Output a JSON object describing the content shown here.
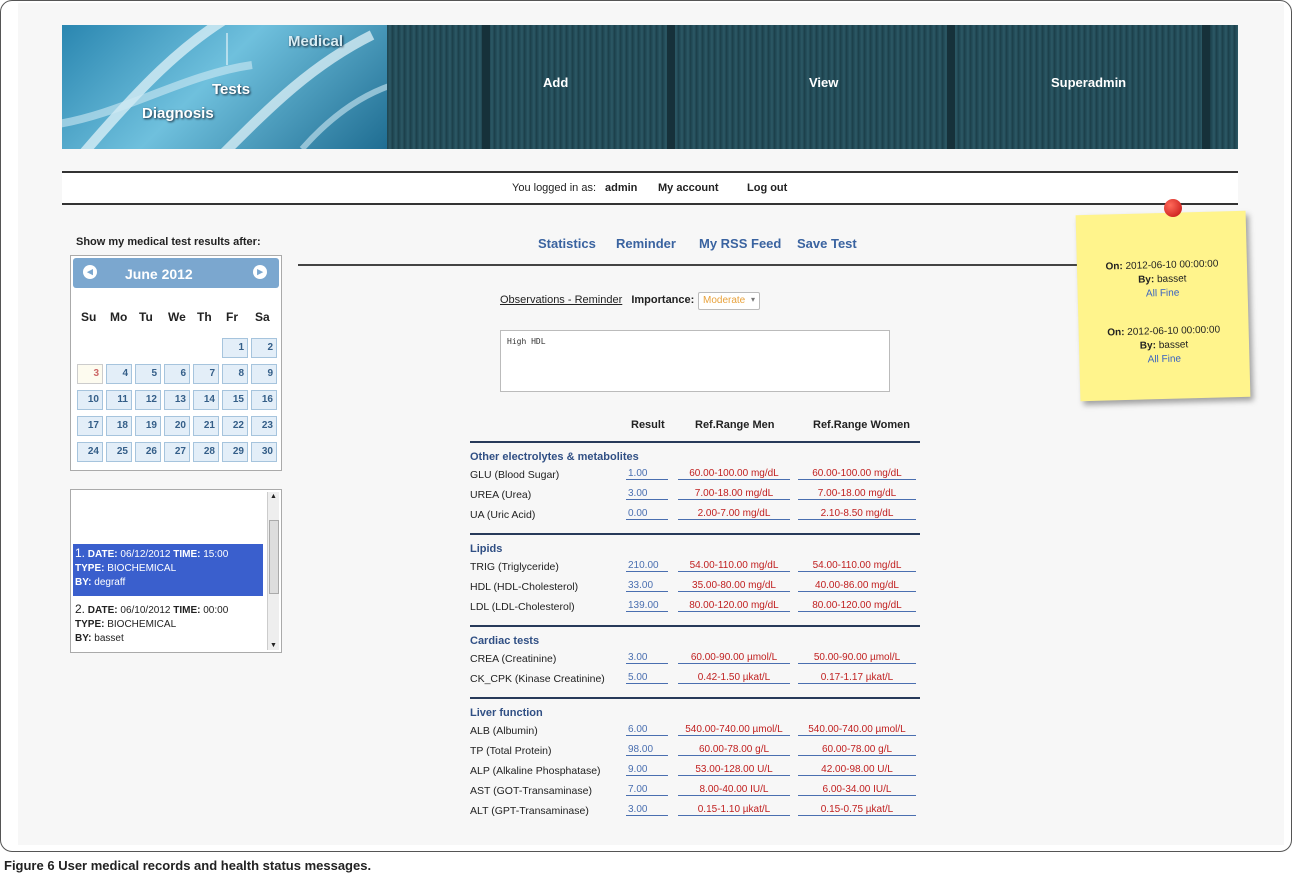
{
  "nav": {
    "logo_words": [
      "Medical",
      "Tests",
      "Diagnosis"
    ],
    "items": [
      "Add",
      "View",
      "Superadmin"
    ]
  },
  "login": {
    "prefix": "You logged in as:",
    "user": "admin",
    "my_account": "My account",
    "logout": "Log out"
  },
  "calendar": {
    "label": "Show my medical test results after:",
    "month": "June 2012",
    "prev_icon": "circle-left-icon",
    "next_icon": "circle-right-icon",
    "weekdays": [
      "Su",
      "Mo",
      "Tu",
      "We",
      "Th",
      "Fr",
      "Sa"
    ],
    "today": "3",
    "weeks": [
      [
        "",
        "",
        "",
        "",
        "",
        "1",
        "2"
      ],
      [
        "3",
        "4",
        "5",
        "6",
        "7",
        "8",
        "9"
      ],
      [
        "10",
        "11",
        "12",
        "13",
        "14",
        "15",
        "16"
      ],
      [
        "17",
        "18",
        "19",
        "20",
        "21",
        "22",
        "23"
      ],
      [
        "24",
        "25",
        "26",
        "27",
        "28",
        "29",
        "30"
      ]
    ]
  },
  "records": [
    {
      "num": "1.",
      "date_label": "DATE:",
      "date": "06/12/2012",
      "time_label": "TIME:",
      "time": "15:00",
      "type_label": "TYPE:",
      "type": "BIOCHEMICAL",
      "by_label": "BY:",
      "by": "degraff"
    },
    {
      "num": "2.",
      "date_label": "DATE:",
      "date": "06/10/2012",
      "time_label": "TIME:",
      "time": "00:00",
      "type_label": "TYPE:",
      "type": "BIOCHEMICAL",
      "by_label": "BY:",
      "by": "basset"
    }
  ],
  "links": [
    "Statistics",
    "Reminder",
    "My RSS Feed",
    "Save Test"
  ],
  "observations": {
    "label": "Observations - Reminder",
    "importance_label": "Importance:",
    "importance_value": "Moderate",
    "notes": "High HDL"
  },
  "table": {
    "headers": [
      "Result",
      "Ref.Range Men",
      "Ref.Range Women"
    ],
    "sections": [
      {
        "title": "Other electrolytes & metabolites",
        "rows": [
          {
            "name": "GLU (Blood Sugar)",
            "result": "1.00",
            "men": "60.00-100.00 mg/dL",
            "women": "60.00-100.00 mg/dL"
          },
          {
            "name": "UREA (Urea)",
            "result": "3.00",
            "men": "7.00-18.00 mg/dL",
            "women": "7.00-18.00 mg/dL"
          },
          {
            "name": "UA (Uric Acid)",
            "result": "0.00",
            "men": "2.00-7.00 mg/dL",
            "women": "2.10-8.50 mg/dL"
          }
        ]
      },
      {
        "title": "Lipids",
        "rows": [
          {
            "name": "TRIG (Triglyceride)",
            "result": "210.00",
            "men": "54.00-110.00 mg/dL",
            "women": "54.00-110.00 mg/dL"
          },
          {
            "name": "HDL (HDL-Cholesterol)",
            "result": "33.00",
            "men": "35.00-80.00 mg/dL",
            "women": "40.00-86.00 mg/dL"
          },
          {
            "name": "LDL (LDL-Cholesterol)",
            "result": "139.00",
            "men": "80.00-120.00 mg/dL",
            "women": "80.00-120.00 mg/dL"
          }
        ]
      },
      {
        "title": "Cardiac tests",
        "rows": [
          {
            "name": "CREA (Creatinine)",
            "result": "3.00",
            "men": "60.00-90.00 µmol/L",
            "women": "50.00-90.00 µmol/L"
          },
          {
            "name": "CK_CPK (Kinase Creatinine)",
            "result": "5.00",
            "men": "0.42-1.50 µkat/L",
            "women": "0.17-1.17 µkat/L"
          }
        ]
      },
      {
        "title": "Liver function",
        "rows": [
          {
            "name": "ALB (Albumin)",
            "result": "6.00",
            "men": "540.00-740.00 µmol/L",
            "women": "540.00-740.00 µmol/L"
          },
          {
            "name": "TP (Total Protein)",
            "result": "98.00",
            "men": "60.00-78.00 g/L",
            "women": "60.00-78.00 g/L"
          },
          {
            "name": "ALP (Alkaline Phosphatase)",
            "result": "9.00",
            "men": "53.00-128.00 U/L",
            "women": "42.00-98.00 U/L"
          },
          {
            "name": "AST (GOT-Transaminase)",
            "result": "7.00",
            "men": "8.00-40.00 IU/L",
            "women": "6.00-34.00 IU/L"
          },
          {
            "name": "ALT (GPT-Transaminase)",
            "result": "3.00",
            "men": "0.15-1.10 µkat/L",
            "women": "0.15-0.75 µkat/L"
          }
        ]
      }
    ]
  },
  "sticky": [
    {
      "on_label": "On:",
      "on": "2012-06-10 00:00:00",
      "by_label": "By:",
      "by": "basset",
      "status": "All Fine"
    },
    {
      "on_label": "On:",
      "on": "2012-06-10 00:00:00",
      "by_label": "By:",
      "by": "basset",
      "status": "All Fine"
    }
  ],
  "caption": {
    "bold": "Figure 6",
    "text": "User medical records and health status messages."
  }
}
